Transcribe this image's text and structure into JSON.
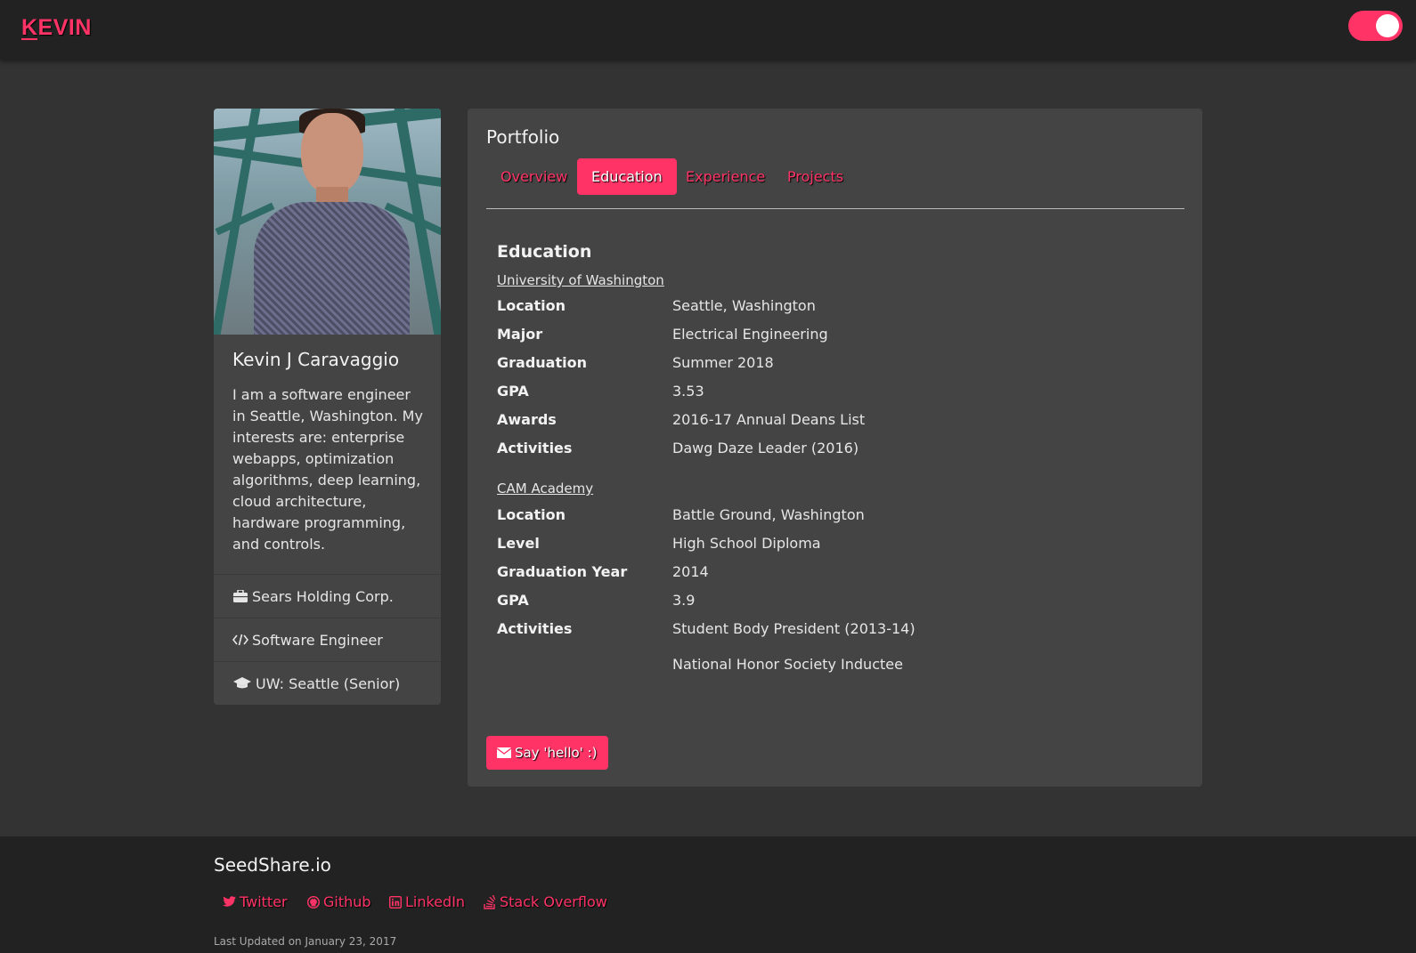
{
  "navbar": {
    "brand": "KEVIN"
  },
  "profile": {
    "name": "Kevin J Caravaggio",
    "bio": "I am a software engineer in Seattle, Washington. My interests are: enterprise webapps, optimization algorithms, deep learning, cloud architecture, hardware programming, and controls.",
    "items": [
      {
        "icon": "briefcase-icon",
        "label": "Sears Holding Corp."
      },
      {
        "icon": "code-icon",
        "label": "Software Engineer"
      },
      {
        "icon": "graduation-cap-icon",
        "label": "UW: Seattle (Senior)"
      }
    ]
  },
  "portfolio": {
    "title": "Portfolio",
    "tabs": [
      "Overview",
      "Education",
      "Experience",
      "Projects"
    ],
    "active_tab": "Education",
    "section_heading": "Education",
    "schools": [
      {
        "name": "University of Washington",
        "rows": [
          {
            "label": "Location",
            "value": "Seattle, Washington"
          },
          {
            "label": "Major",
            "value": "Electrical Engineering"
          },
          {
            "label": "Graduation",
            "value": "Summer 2018"
          },
          {
            "label": "GPA",
            "value": "3.53"
          },
          {
            "label": "Awards",
            "value": "2016-17 Annual Deans List"
          },
          {
            "label": "Activities",
            "value": "Dawg Daze Leader (2016)"
          }
        ]
      },
      {
        "name": "CAM Academy",
        "rows": [
          {
            "label": "Location",
            "value": "Battle Ground, Washington"
          },
          {
            "label": "Level",
            "value": "High School Diploma"
          },
          {
            "label": "Graduation Year",
            "value": "2014"
          },
          {
            "label": "GPA",
            "value": "3.9"
          },
          {
            "label": "Activities",
            "value": "Student Body President (2013-14)"
          }
        ],
        "extra_value": "National Honor Society Inductee"
      }
    ],
    "hello_button": "Say 'hello' :)"
  },
  "footer": {
    "title": "SeedShare.io",
    "links": [
      {
        "icon": "twitter-icon",
        "label": "Twitter"
      },
      {
        "icon": "github-icon",
        "label": "Github"
      },
      {
        "icon": "linkedin-icon",
        "label": "LinkedIn"
      },
      {
        "icon": "stack-overflow-icon",
        "label": "Stack Overflow"
      }
    ],
    "updated": "Last Updated on January 23, 2017"
  },
  "colors": {
    "accent": "#ff3366",
    "background": "#333333",
    "panel": "#444444",
    "navbar": "#222222"
  }
}
